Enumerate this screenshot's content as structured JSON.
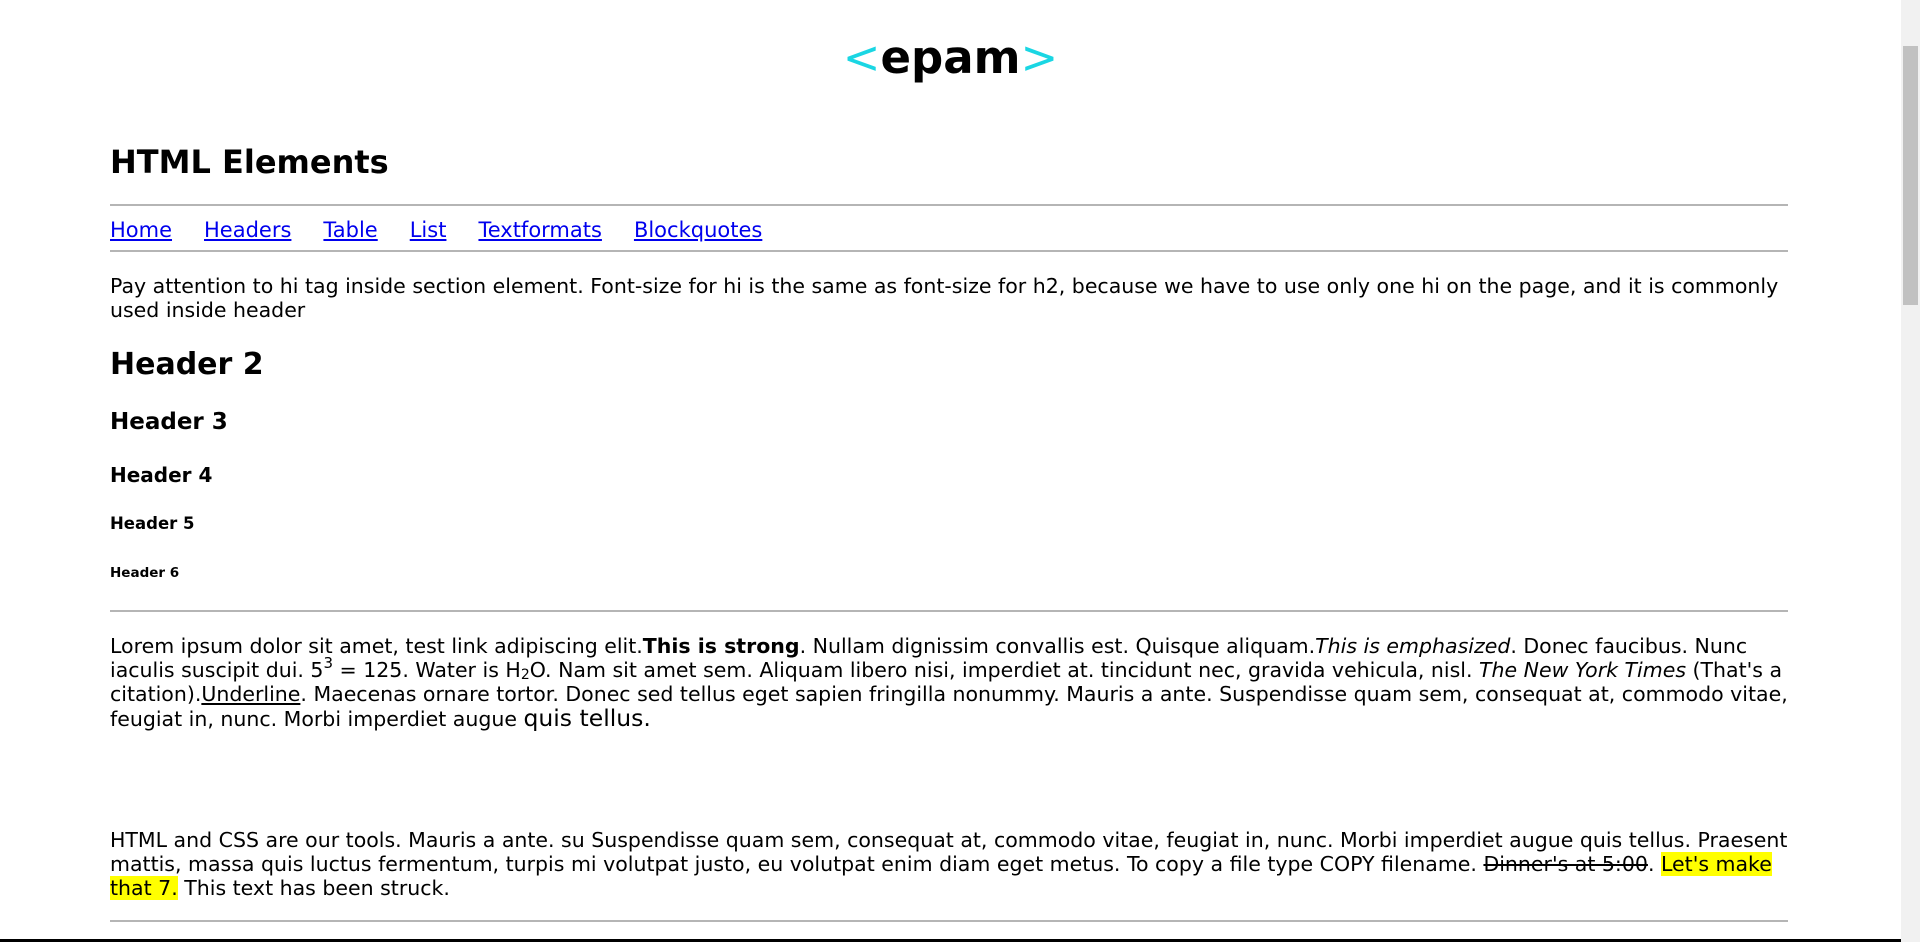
{
  "logo": {
    "open": "<",
    "word": "epam",
    "close": ">",
    "accent_color": "#1ad6e3"
  },
  "page_title": "HTML Elements",
  "nav": {
    "items": [
      {
        "label": "Home"
      },
      {
        "label": "Headers"
      },
      {
        "label": "Table"
      },
      {
        "label": "List"
      },
      {
        "label": "Textformats"
      },
      {
        "label": "Blockquotes"
      }
    ]
  },
  "intro": "Pay attention to hi tag inside section element. Font-size for hi is the same as font-size for h2, because we have to use only one hi on the page, and it is commonly used inside header",
  "headers": {
    "h2": "Header 2",
    "h3": "Header 3",
    "h4": "Header 4",
    "h5": "Header 5",
    "h6": "Header 6"
  },
  "paragraph1": {
    "p1": "Lorem ipsum dolor sit amet, test link adipiscing elit.",
    "strong": "This is strong",
    "p2": ". Nullam dignissim convallis est. Quisque aliquam.",
    "em": "This is emphasized",
    "p3": ". Donec faucibus. Nunc iaculis suscipit dui. 5",
    "sup": "3",
    "p4": " = 125. Water is H",
    "sub": "2",
    "p5": "O. Nam sit amet sem. Aliquam libero nisi, imperdiet at. tincidunt nec, gravida vehicula, nisl. ",
    "cite": "The New York Times",
    "p6": " (That's a citation).",
    "underline": "Underline",
    "p7": ". Maecenas ornare tortor. Donec sed tellus eget sapien fringilla nonummy. Mauris a ante. Suspendisse quam sem, consequat at, commodo vitae, feugiat in, nunc. Morbi imperdiet augue ",
    "big": "quis tellus."
  },
  "paragraph2": {
    "p1": "HTML and CSS are our tools. Mauris a ante. su Suspendisse quam sem, consequat at, commodo vitae, feugiat in, nunc. Morbi imperdiet augue quis tellus. Praesent mattis, massa quis luctus fermentum, turpis mi volutpat justo, eu volutpat enim diam eget metus. To copy a file type COPY filename. ",
    "struck": "Dinner's at 5:00",
    "p2": ". ",
    "highlight": "Let's make that 7.",
    "p3": " This text has been struck."
  },
  "colors": {
    "link": "#0000ee",
    "rule": "#b5b5b5",
    "highlight": "#ffff00"
  }
}
